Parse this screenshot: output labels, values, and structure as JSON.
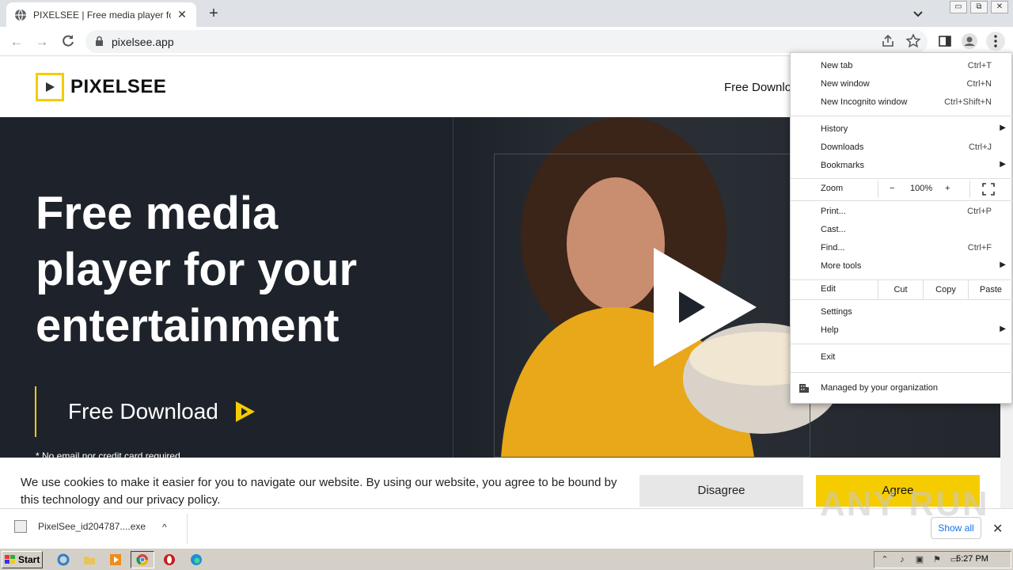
{
  "browser": {
    "tab_title": "PIXELSEE | Free media player for yo",
    "url": "pixelsee.app",
    "window_buttons": [
      "▭",
      "⧉",
      "✕"
    ]
  },
  "site": {
    "logo_text": "PIXELSEE",
    "nav_link": "Free Downlo",
    "hero_line1": "Free media",
    "hero_line2": "player for your",
    "hero_line3": "entertainment",
    "cta_label": "Free Download",
    "note": "* No email nor credit card required",
    "brand_color": "#f5cc00"
  },
  "cookie": {
    "text": "We use cookies to make it easier for you to navigate our website. By using our website, you agree to be bound by this technology and our privacy policy.",
    "disagree": "Disagree",
    "agree": "Agree"
  },
  "menu": {
    "new_tab": "New tab",
    "new_tab_sc": "Ctrl+T",
    "new_window": "New window",
    "new_window_sc": "Ctrl+N",
    "incognito": "New Incognito window",
    "incognito_sc": "Ctrl+Shift+N",
    "history": "History",
    "downloads": "Downloads",
    "downloads_sc": "Ctrl+J",
    "bookmarks": "Bookmarks",
    "zoom": "Zoom",
    "zoom_minus": "−",
    "zoom_level": "100%",
    "zoom_plus": "+",
    "print": "Print...",
    "print_sc": "Ctrl+P",
    "cast": "Cast...",
    "find": "Find...",
    "find_sc": "Ctrl+F",
    "more_tools": "More tools",
    "edit": "Edit",
    "cut": "Cut",
    "copy": "Copy",
    "paste": "Paste",
    "settings": "Settings",
    "help": "Help",
    "exit": "Exit",
    "managed": "Managed by your organization"
  },
  "download": {
    "filename": "PixelSee_id204787....exe",
    "show_all": "Show all"
  },
  "watermark": "ANY RUN",
  "taskbar": {
    "start": "Start",
    "time": "5:27 PM"
  }
}
